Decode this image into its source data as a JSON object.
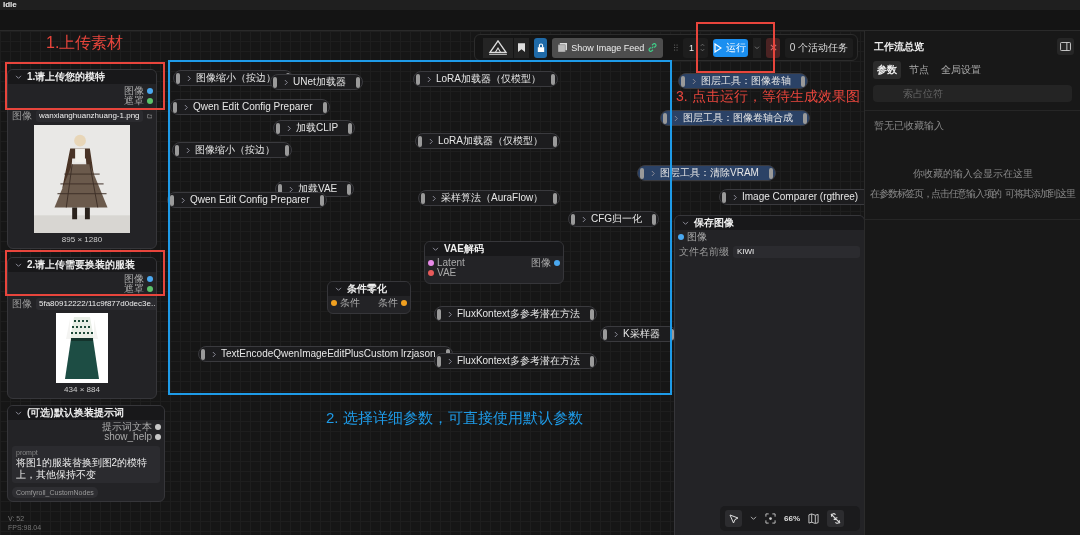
{
  "window": {
    "title": "Idle"
  },
  "toolbar": {
    "feed_button": "Show Image Feed",
    "canvas_locked": true,
    "batch_count": "1",
    "run_button": "运行",
    "active_tasks": "0 个活动任务"
  },
  "nodes": [
    {
      "kind": "image_loader",
      "title": "1.请上传您的模特",
      "outputs": [
        {
          "label": "图像",
          "color": "#4aa8f0"
        },
        {
          "label": "遮罩",
          "color": "#5cc26a"
        }
      ],
      "widget_label": "图像",
      "filename": "wanxianghuanzhuang-1.png",
      "dimensions": "895 × 1280"
    },
    {
      "kind": "image_loader",
      "title": "2.请上传需要换装的服装",
      "outputs": [
        {
          "label": "图像",
          "color": "#4aa8f0"
        },
        {
          "label": "遮罩",
          "color": "#5cc26a"
        }
      ],
      "widget_label": "图像",
      "filename": "5fa80912222/11c9f877d0dec3e...",
      "dimensions": "434 × 884"
    },
    {
      "kind": "prompt",
      "title": "(可选)默认换装提示词",
      "outputs": [
        {
          "label": "提示词文本",
          "color": "#c8c8c8"
        },
        {
          "label": "show_help",
          "color": "#c8c8c8"
        }
      ],
      "field_label": "prompt",
      "text": "将图1的服装替换到图2的模特上，其他保持不变",
      "badge": "Comfyroll_CustomNodes"
    },
    {
      "kind": "collapsed",
      "title": "图像缩小（按边）",
      "color": "#1c1c1e"
    },
    {
      "kind": "collapsed",
      "title": "UNet加载器",
      "color": "#1c1c1e"
    },
    {
      "kind": "collapsed",
      "title": "LoRA加载器（仅模型）",
      "color": "#1c1c1e"
    },
    {
      "kind": "collapsed",
      "title": "图层工具：图像卷轴",
      "color": "#2b4266"
    },
    {
      "kind": "collapsed",
      "title": "Qwen Edit Config Preparer",
      "color": "#1c1c1e"
    },
    {
      "kind": "collapsed",
      "title": "加载CLIP",
      "color": "#1c1c1e"
    },
    {
      "kind": "collapsed",
      "title": "图层工具：图像卷轴合成",
      "color": "#2b4266"
    },
    {
      "kind": "collapsed",
      "title": "LoRA加载器（仅模型）",
      "color": "#1c1c1e"
    },
    {
      "kind": "collapsed",
      "title": "图像缩小（按边）",
      "color": "#1c1c1e"
    },
    {
      "kind": "collapsed",
      "title": "图层工具：清除VRAM",
      "color": "#2b4266"
    },
    {
      "kind": "collapsed",
      "title": "加载VAE",
      "color": "#1c1c1e"
    },
    {
      "kind": "collapsed",
      "title": "Qwen Edit Config Preparer",
      "color": "#1c1c1e"
    },
    {
      "kind": "collapsed",
      "title": "采样算法（AuraFlow）",
      "color": "#1c1c1e"
    },
    {
      "kind": "collapsed",
      "title": "Image Comparer (rgthree)",
      "color": "#1c1c1e"
    },
    {
      "kind": "collapsed",
      "title": "CFG归一化",
      "color": "#1c1c1e"
    },
    {
      "kind": "expanded",
      "title": "VAE解码",
      "inputs": [
        {
          "label": "Latent",
          "color": "#e88ae8"
        },
        {
          "label": "VAE",
          "color": "#e85a5a"
        }
      ],
      "outputs": [
        {
          "label": "图像",
          "color": "#4aa8f0"
        }
      ]
    },
    {
      "kind": "expanded",
      "title": "条件零化",
      "inputs": [
        {
          "label": "条件",
          "color": "#f0a020"
        }
      ],
      "outputs": [
        {
          "label": "条件",
          "color": "#f0a020"
        }
      ]
    },
    {
      "kind": "collapsed",
      "title": "FluxKontext多参考潜在方法",
      "color": "#1c1c1e"
    },
    {
      "kind": "collapsed",
      "title": "K采样器",
      "color": "#1c1c1e"
    },
    {
      "kind": "collapsed",
      "title": "TextEncodeQwenImageEditPlusCustom lrzjason",
      "color": "#1c1c1e"
    },
    {
      "kind": "collapsed",
      "title": "FluxKontext多参考潜在方法",
      "color": "#1c1c1e"
    },
    {
      "kind": "save",
      "title": "保存图像",
      "inputs": [
        {
          "label": "图像",
          "color": "#4aa8f0"
        }
      ],
      "widget_label": "文件名前缀",
      "value": "KIWI"
    }
  ],
  "zoom": "66%",
  "annotations": [
    {
      "text": "1.上传素材",
      "color": "#e8453c"
    },
    {
      "text": "2. 选择详细参数，可直接使用默认参数",
      "color": "#1e9be8"
    },
    {
      "text": "3. 点击运行，等待生成效果图",
      "color": "#e8453c"
    }
  ],
  "side_panel": {
    "title": "工作流总览",
    "tabs": [
      {
        "label": "参数",
        "selected": true
      },
      {
        "label": "节点",
        "selected": false
      },
      {
        "label": "全局设置",
        "selected": false
      }
    ],
    "search_placeholder": "索占位符",
    "empty_heading": "暂无已收藏输入",
    "empty_title": "你收藏的输入会显示在这里",
    "hint_before": "在参数标签页，点击任意输入项的",
    "hint_after": "可将其添加到这里"
  },
  "stats": [
    "V: 52",
    "FPS:98.04"
  ]
}
